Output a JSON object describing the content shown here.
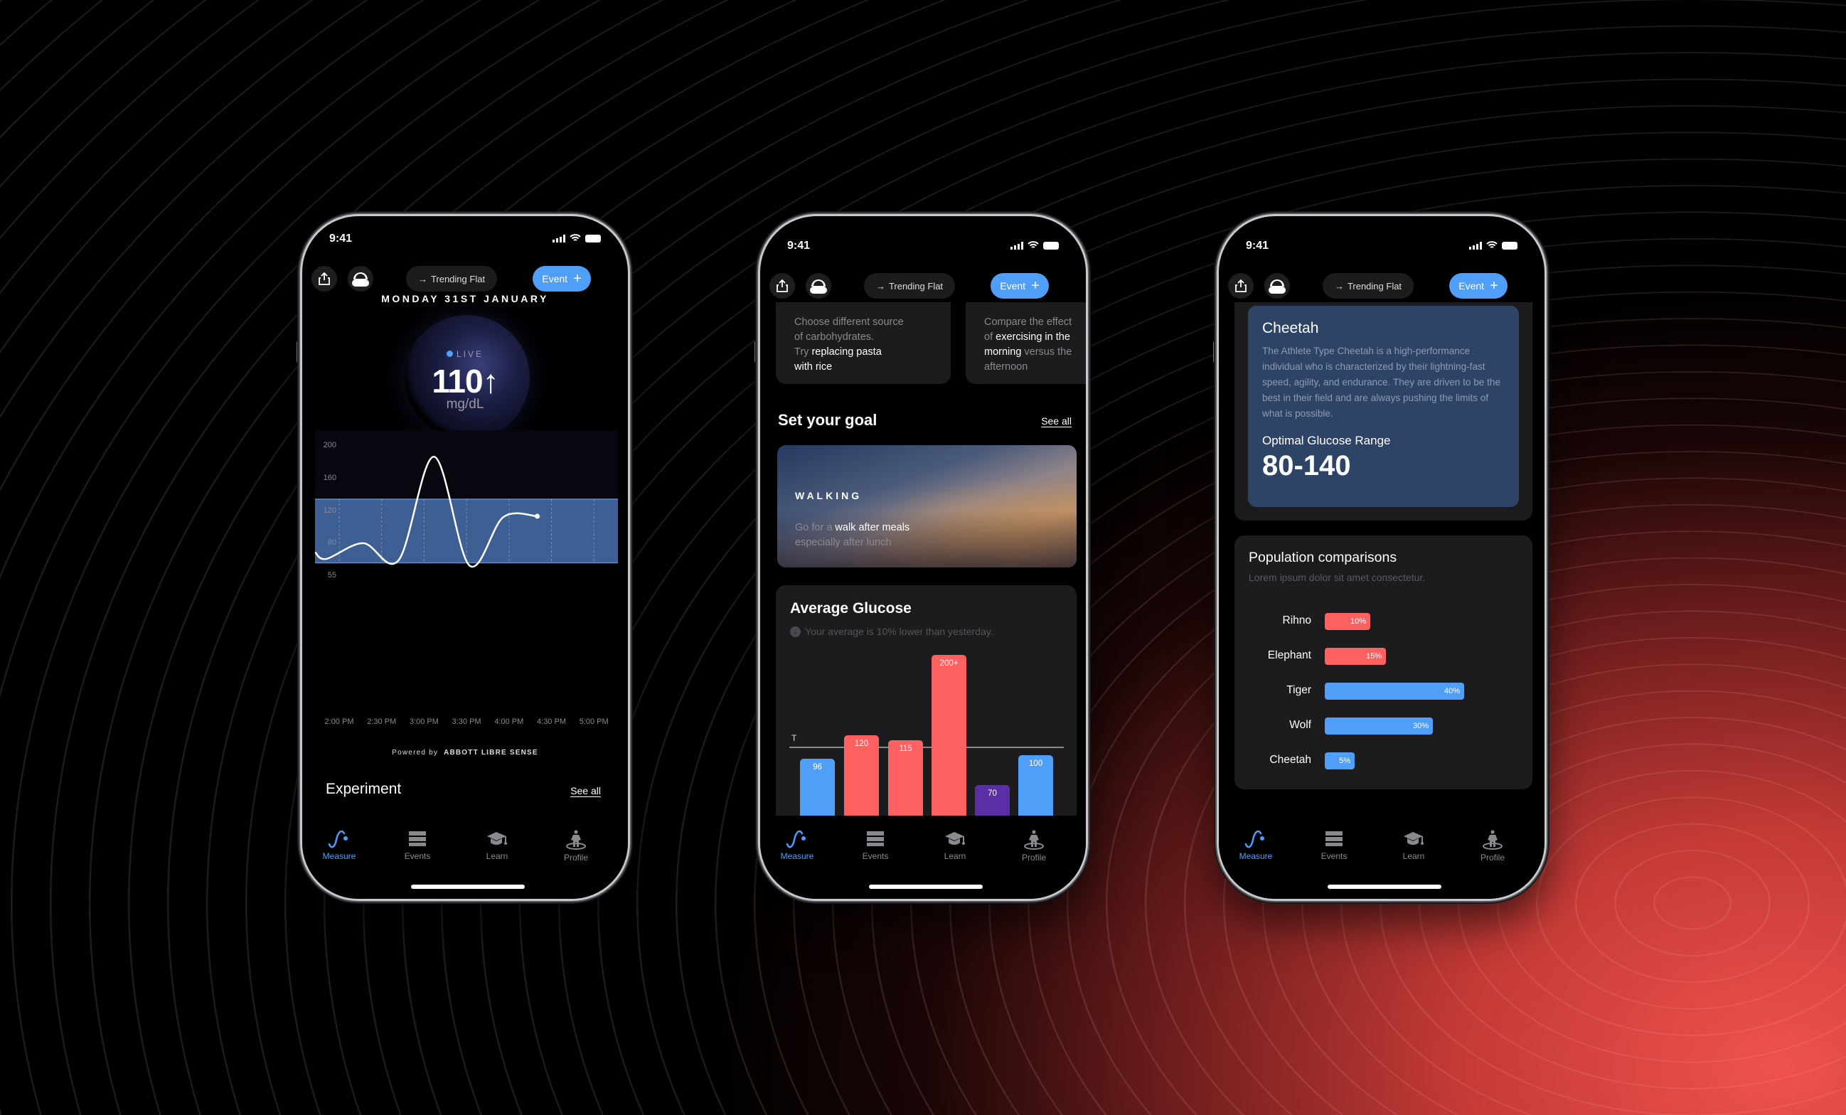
{
  "status_bar": {
    "time": "9:41"
  },
  "header": {
    "share_icon": "share-icon",
    "avatar_icon": "helmet-avatar-icon",
    "trend_arrow": "→",
    "trend_label": "Trending Flat",
    "event_label": "Event",
    "event_plus": "+"
  },
  "tabs": [
    {
      "label": "Measure",
      "icon": "wave-icon",
      "active": true
    },
    {
      "label": "Events",
      "icon": "stack-icon",
      "active": false
    },
    {
      "label": "Learn",
      "icon": "graduation-cap-icon",
      "active": false
    },
    {
      "label": "Profile",
      "icon": "person-icon",
      "active": false
    }
  ],
  "colors": {
    "accent": "#4f9ef8",
    "high": "#ff6161",
    "low": "#5b2ea6",
    "athlete_card": "#2e4466",
    "card": "#1c1c1e",
    "target_band": "#3d5f93"
  },
  "phone1": {
    "date": "MONDAY 31ST JANUARY",
    "live_label": "LIVE",
    "glucose_value": "110",
    "trend_arrow": "↑",
    "unit": "mg/dL",
    "powered_by": "Powered by",
    "powered_brand": "ABBOTT LIBRE SENSE",
    "section_title": "Experiment",
    "see_all": "See all",
    "chart": {
      "type": "line",
      "y_ticks": [
        "200",
        "160",
        "120",
        "80",
        "55"
      ],
      "x_ticks": [
        "2:00 PM",
        "2:30 PM",
        "3:00 PM",
        "3:30 PM",
        "4:00 PM",
        "4:30 PM",
        "5:00 PM"
      ],
      "target_range": [
        64,
        133
      ],
      "series": [
        {
          "time": "1:43 PM",
          "value": 72
        },
        {
          "time": "1:51 PM",
          "value": 67
        },
        {
          "time": "2:17 PM",
          "value": 79
        },
        {
          "time": "2:42 PM",
          "value": 66
        },
        {
          "time": "3:07 PM",
          "value": 185
        },
        {
          "time": "3:32 PM",
          "value": 62
        },
        {
          "time": "3:56 PM",
          "value": 111
        },
        {
          "time": "4:20 PM",
          "value": 112
        }
      ]
    }
  },
  "phone2": {
    "cards": [
      {
        "segments": [
          {
            "text": "Choose different source",
            "em": false,
            "br": true
          },
          {
            "text": "of carbohydrates.",
            "em": false,
            "br": true
          },
          {
            "text": "Try ",
            "em": false
          },
          {
            "text": "replacing pasta",
            "em": true,
            "br": true
          },
          {
            "text": "with rice",
            "em": true
          }
        ]
      },
      {
        "segments": [
          {
            "text": "Compare the effect",
            "em": false,
            "br": true
          },
          {
            "text": "of ",
            "em": false
          },
          {
            "text": "exercising in the",
            "em": true,
            "br": true
          },
          {
            "text": "morning",
            "em": true
          },
          {
            "text": " versus the",
            "em": false,
            "br": true
          },
          {
            "text": "afternoon",
            "em": false
          }
        ]
      }
    ],
    "goal_title": "Set your goal",
    "see_all": "See all",
    "goal_card": {
      "title": "WALKING",
      "segments": [
        {
          "text": "Go for a ",
          "em": false
        },
        {
          "text": "walk after meals",
          "em": true
        },
        {
          "text": ",",
          "em": false,
          "br": true
        },
        {
          "text": "especially after lunch",
          "em": false
        }
      ]
    },
    "average": {
      "title": "Average Glucose",
      "subtitle": "Your average is 10% lower than yesterday.",
      "subtitle_icon": "arrow-down-circle-icon",
      "target_label": "T",
      "chart_type": "bar",
      "bars": [
        {
          "label": "96",
          "value": 96,
          "color": "#4f9ef8"
        },
        {
          "label": "120",
          "value": 120,
          "color": "#ff6161"
        },
        {
          "label": "115",
          "value": 115,
          "color": "#ff6161"
        },
        {
          "label": "200+",
          "value": 200,
          "color": "#ff6161"
        },
        {
          "label": "70",
          "value": 70,
          "color": "#5b2ea6"
        },
        {
          "label": "100",
          "value": 100,
          "color": "#4f9ef8"
        }
      ]
    }
  },
  "phone3": {
    "athlete": {
      "name": "Cheetah",
      "description": "The Athlete Type Cheetah is a high-performance individual who is characterized by their lightning-fast speed, agility, and endurance. They are driven to be the best in their field and are always pushing the limits of what is possible.",
      "range_label": "Optimal Glucose Range",
      "range": "80-140"
    },
    "population": {
      "title": "Population comparisons",
      "subtitle": "Lorem ipsum dolor sit amet consectetur.",
      "rows": [
        {
          "label": "Rihno",
          "percent": 10,
          "text": "10%",
          "color": "#ff6161"
        },
        {
          "label": "Elephant",
          "percent": 15,
          "text": "15%",
          "color": "#ff6161"
        },
        {
          "label": "Tiger",
          "percent": 40,
          "text": "40%",
          "color": "#4f9ef8"
        },
        {
          "label": "Wolf",
          "percent": 30,
          "text": "30%",
          "color": "#4f9ef8"
        },
        {
          "label": "Cheetah",
          "percent": 5,
          "text": "5%",
          "color": "#4f9ef8"
        }
      ]
    }
  }
}
